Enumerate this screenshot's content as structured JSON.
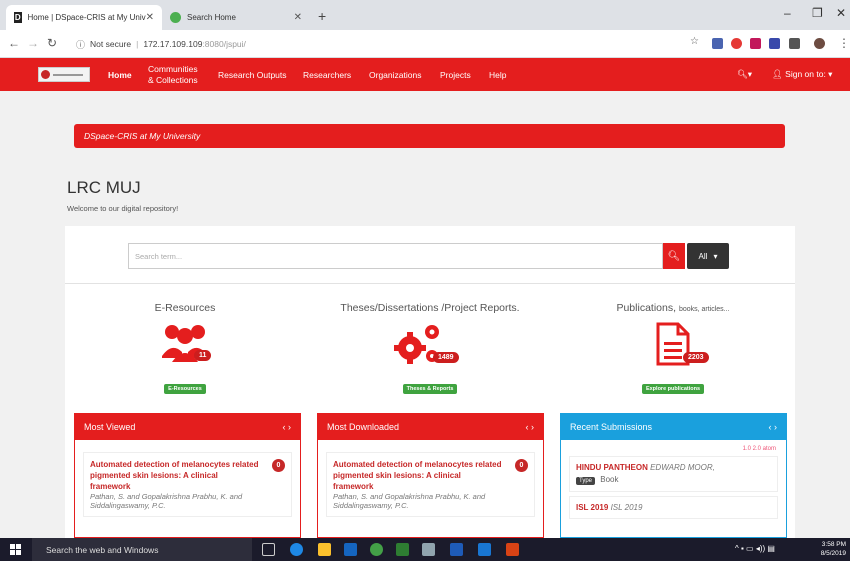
{
  "browser": {
    "tabs": [
      {
        "label": "Home | DSpace-CRIS at My Univ",
        "active": true
      },
      {
        "label": "Search Home",
        "active": false
      }
    ],
    "url_secure_label": "Not secure",
    "url_host": "172.17.109.109",
    "url_path": ":8080/jspui/"
  },
  "navbar": {
    "links": [
      {
        "label": "Home"
      },
      {
        "label": "Communities"
      },
      {
        "label": "& Collections"
      },
      {
        "label": "Research Outputs"
      },
      {
        "label": "Researchers"
      },
      {
        "label": "Organizations"
      },
      {
        "label": "Projects"
      },
      {
        "label": "Help"
      }
    ],
    "signin_label": "Sign on to:"
  },
  "banner": {
    "text": "DSpace-CRIS at My University"
  },
  "site": {
    "title": "LRC MUJ",
    "welcome": "Welcome to our digital repository!"
  },
  "search": {
    "placeholder": "Search term...",
    "scope_label": "All"
  },
  "categories": [
    {
      "title": "E-Resources",
      "count": "11",
      "button": "E-Resources",
      "icon": "users-icon"
    },
    {
      "title": "Theses/Dissertations /Project Reports.",
      "count": "1489",
      "button": "Theses & Reports",
      "icon": "gears-icon"
    },
    {
      "title": "Publications,",
      "subtitle": "books, articles...",
      "count": "2203",
      "button": "Explore publications",
      "icon": "document-icon"
    }
  ],
  "boxes": {
    "most_viewed": {
      "title": "Most Viewed",
      "item_title": "Automated detection of melanocytes related pigmented skin lesions: A clinical framework",
      "item_authors": "Pathan, S. and Gopalakrishna Prabhu, K. and Siddalingaswamy, P.C.",
      "item_count": "0"
    },
    "most_downloaded": {
      "title": "Most Downloaded",
      "item_title": "Automated detection of melanocytes related pigmented skin lesions: A clinical framework",
      "item_authors": "Pathan, S. and Gopalakrishna Prabhu, K. and Siddalingaswamy, P.C.",
      "item_count": "0"
    },
    "recent": {
      "title": "Recent Submissions",
      "feeds": "1.0  2.0  atom",
      "sub1_title": "HINDU PANTHEON",
      "sub1_author": "EDWARD MOOR,",
      "sub1_type_label": "Type",
      "sub1_type": "Book",
      "sub2_title": "ISL 2019",
      "sub2_author": "ISL 2019"
    }
  },
  "taskbar": {
    "search_placeholder": "Search the web and Windows",
    "time": "3:58 PM",
    "date": "8/5/2019"
  }
}
